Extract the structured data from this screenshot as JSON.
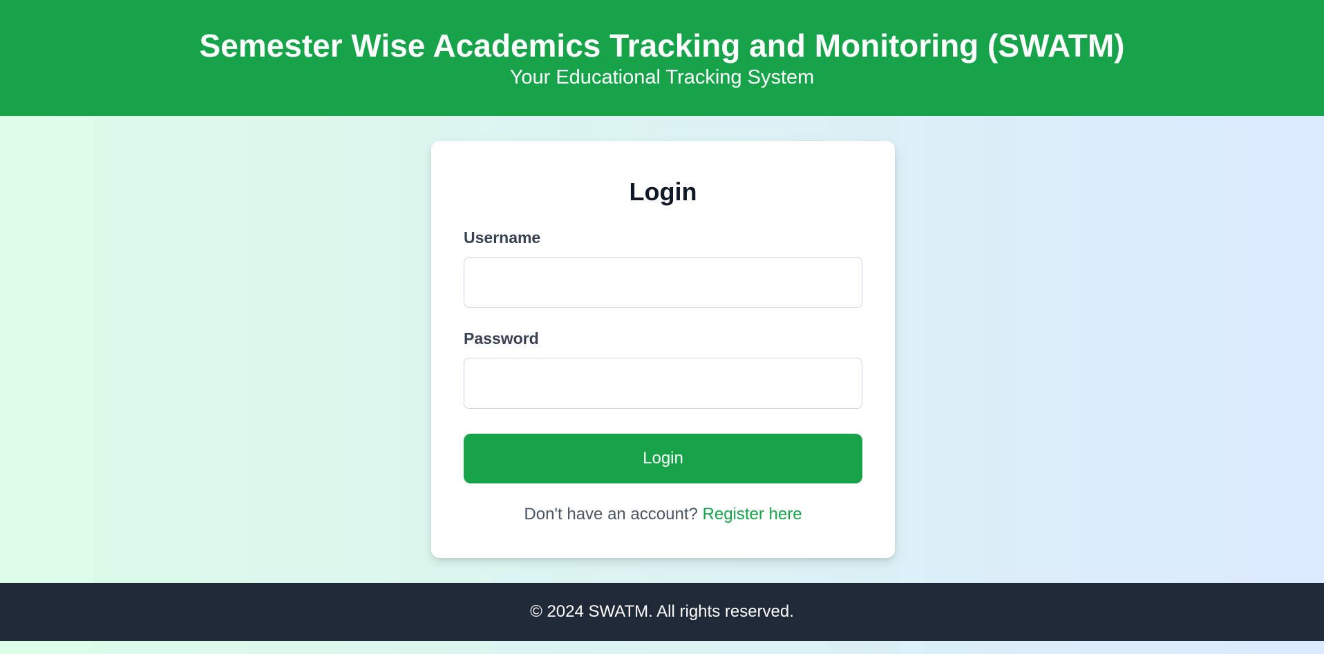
{
  "header": {
    "title": "Semester Wise Academics Tracking and Monitoring (SWATM)",
    "subtitle": "Your Educational Tracking System"
  },
  "login_form": {
    "title": "Login",
    "username_label": "Username",
    "username_value": "",
    "password_label": "Password",
    "password_value": "",
    "submit_label": "Login",
    "register_prompt": "Don't have an account?",
    "register_link": "Register here"
  },
  "footer": {
    "text": "© 2024 SWATM. All rights reserved."
  },
  "colors": {
    "brand_green": "#16a34a",
    "footer_bg": "#1f2937",
    "background_gradient_start": "#dcfce7",
    "background_gradient_end": "#dbeafe"
  }
}
